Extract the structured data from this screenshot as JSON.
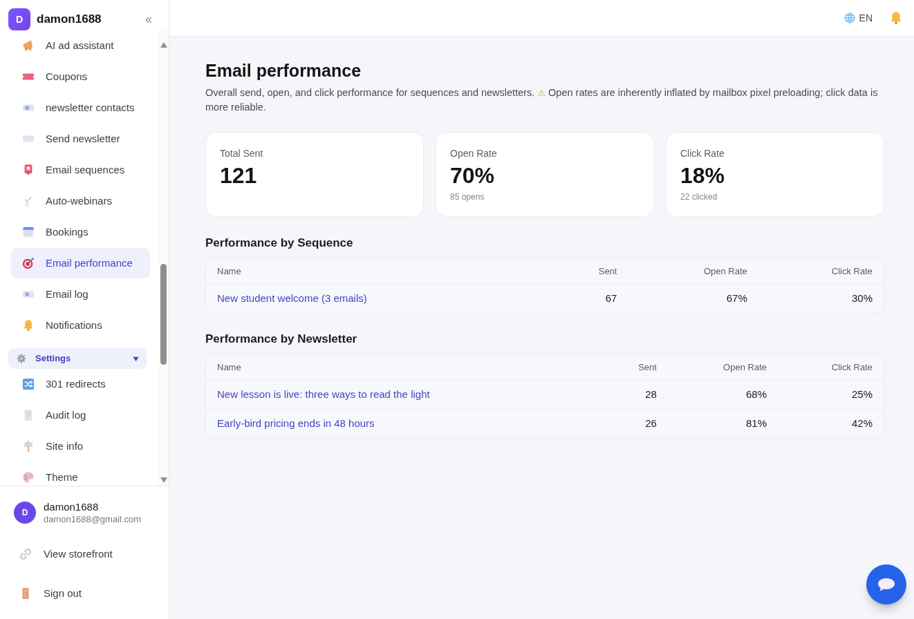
{
  "sidebar": {
    "brand": {
      "avatar_letter": "D",
      "name": "damon1688"
    },
    "items": [
      {
        "kind": "link",
        "label": "AI ad assistant",
        "selected": false
      },
      {
        "kind": "link",
        "label": "Coupons",
        "selected": false
      },
      {
        "kind": "link",
        "label": "newsletter contacts",
        "selected": false
      },
      {
        "kind": "link",
        "label": "Send newsletter",
        "selected": false
      },
      {
        "kind": "link",
        "label": "Email sequences",
        "selected": false
      },
      {
        "kind": "link",
        "label": "Auto-webinars",
        "selected": false
      },
      {
        "kind": "link",
        "label": "Bookings",
        "selected": false
      },
      {
        "kind": "link",
        "label": "Email performance",
        "selected": true
      },
      {
        "kind": "link",
        "label": "Email log",
        "selected": false
      },
      {
        "kind": "link",
        "label": "Notifications",
        "selected": false
      },
      {
        "kind": "group",
        "label": "Settings",
        "expanded": true,
        "children": [
          {
            "label": "301 redirects",
            "selected": false
          },
          {
            "label": "Audit log",
            "selected": false
          },
          {
            "label": "Site info",
            "selected": false
          },
          {
            "label": "Theme",
            "selected": false
          }
        ]
      }
    ],
    "account": {
      "avatar_letter": "D",
      "name": "damon1688",
      "email": "damon1688@gmail.com"
    },
    "footer_links": [
      "View storefront",
      "Sign out"
    ]
  },
  "topbar": {
    "language": "EN"
  },
  "page": {
    "title": "Email performance",
    "summary": "Overall send, open, and click performance for sequences and newsletters.",
    "warning_sign": "⚠",
    "warning": "Open rates are inherently inflated by mailbox pixel preloading; click data is more reliable."
  },
  "stats": [
    {
      "label": "Total Sent",
      "value": "121"
    },
    {
      "label": "Open Rate",
      "value": "70%",
      "detail": "85 opens"
    },
    {
      "label": "Click Rate",
      "value": "18%",
      "detail": "22 clicked"
    }
  ],
  "tables": [
    {
      "title": "Performance by Sequence",
      "columns": [
        "Name",
        "Sent",
        "Open Rate",
        "Click Rate"
      ],
      "rows": [
        [
          "New student welcome (3 emails)",
          "67",
          "67%",
          "30%"
        ]
      ]
    },
    {
      "title": "Performance by Newsletter",
      "columns": [
        "Name",
        "Sent",
        "Open Rate",
        "Click Rate"
      ],
      "rows": [
        [
          "New lesson is live: three ways to read the light",
          "28",
          "68%",
          "25%"
        ],
        [
          "Early-bird pricing ends in 48 hours",
          "26",
          "81%",
          "42%"
        ]
      ]
    }
  ]
}
